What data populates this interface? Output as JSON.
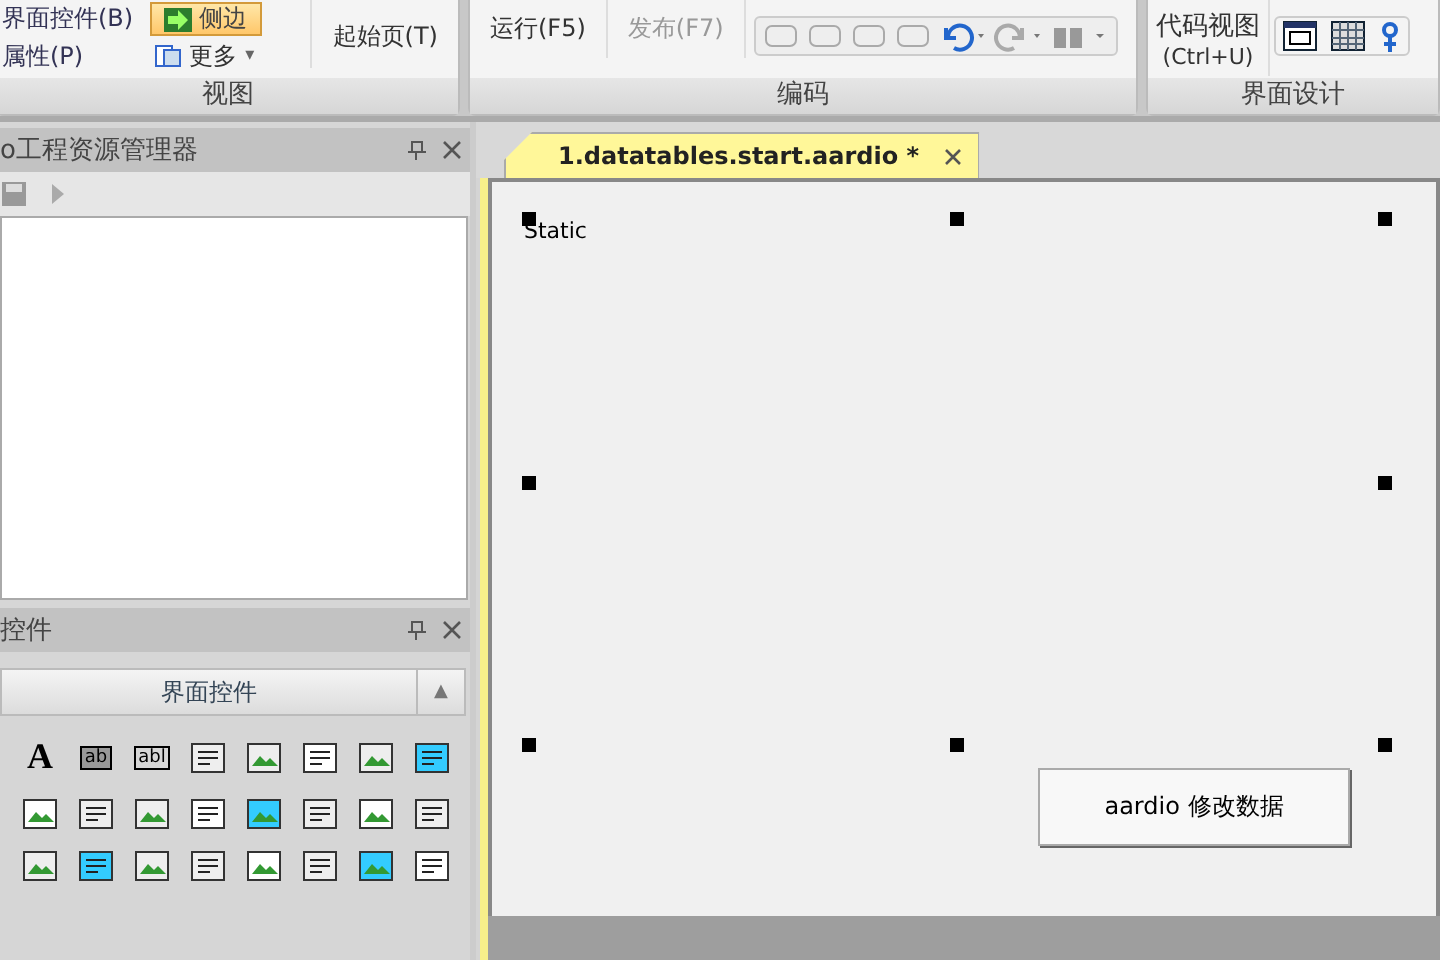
{
  "ribbon": {
    "groups": [
      {
        "title": "视图",
        "items": [
          {
            "label": "界面控件(B)",
            "kind": "text"
          },
          {
            "label": "侧边",
            "kind": "active"
          },
          {
            "label": "属性(P)",
            "kind": "text"
          },
          {
            "label": "更多",
            "kind": "more",
            "caret": "▾"
          },
          {
            "label": "起始页(T)",
            "kind": "big"
          }
        ]
      },
      {
        "title": "编码",
        "items": [
          {
            "label": "运行(F5)",
            "kind": "big"
          },
          {
            "label": "发布(F7)",
            "kind": "disabled"
          },
          {
            "kind": "tools"
          }
        ]
      },
      {
        "title": "界面设计",
        "items": [
          {
            "label": "代码视图",
            "kind": "big"
          },
          {
            "label": "(Ctrl+U)",
            "kind": "sub"
          },
          {
            "kind": "designtools"
          }
        ]
      }
    ]
  },
  "project_panel": {
    "title": "o工程资源管理器"
  },
  "toolbox_panel": {
    "title": "控件",
    "tab": "界面控件",
    "collapse": "▲",
    "text_tools": [
      "A",
      "ab",
      "abl"
    ]
  },
  "editor": {
    "tab": {
      "label": "1.datatables.start.aardio *",
      "selected": true
    },
    "canvas": {
      "static_label": "Static",
      "button": "aardio 修改数据"
    }
  }
}
